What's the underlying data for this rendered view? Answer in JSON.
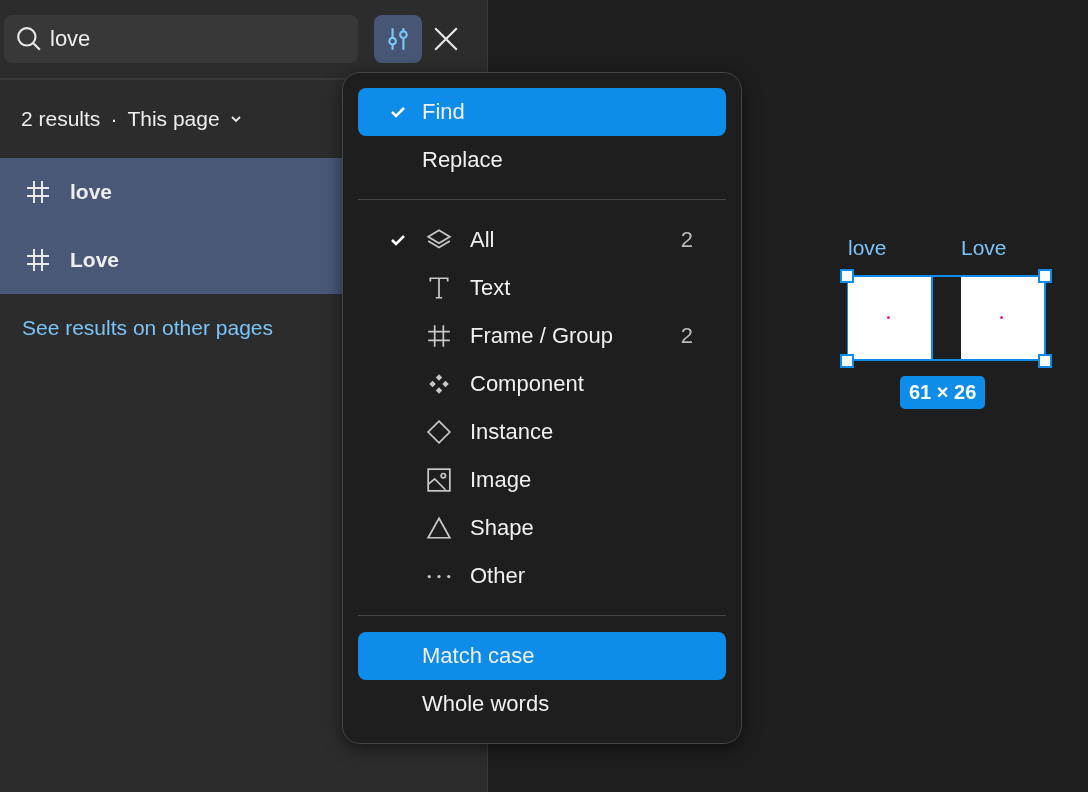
{
  "search": {
    "value": "love"
  },
  "filter_button": {
    "active": true
  },
  "summary": {
    "count": "2 results",
    "separator": "·",
    "scope": "This page"
  },
  "results": [
    {
      "name": "love",
      "selected": true
    },
    {
      "name": "Love",
      "selected": true
    }
  ],
  "other_pages_link": "See results on other pages",
  "menu": {
    "modes": [
      {
        "label": "Find",
        "checked": true,
        "highlighted": true
      },
      {
        "label": "Replace",
        "checked": false,
        "highlighted": false
      }
    ],
    "types": [
      {
        "label": "All",
        "kind": "layers",
        "checked": true,
        "count": "2"
      },
      {
        "label": "Text",
        "kind": "text",
        "checked": false
      },
      {
        "label": "Frame / Group",
        "kind": "frame",
        "checked": false,
        "count": "2"
      },
      {
        "label": "Component",
        "kind": "component",
        "checked": false
      },
      {
        "label": "Instance",
        "kind": "instance",
        "checked": false
      },
      {
        "label": "Image",
        "kind": "image",
        "checked": false
      },
      {
        "label": "Shape",
        "kind": "shape",
        "checked": false
      },
      {
        "label": "Other",
        "kind": "other",
        "checked": false
      }
    ],
    "options": [
      {
        "label": "Match case",
        "checked": false,
        "highlighted": true
      },
      {
        "label": "Whole words",
        "checked": false,
        "highlighted": false
      }
    ]
  },
  "canvas": {
    "frames": [
      {
        "name": "love"
      },
      {
        "name": "Love"
      }
    ],
    "size_badge": "61 × 26"
  }
}
